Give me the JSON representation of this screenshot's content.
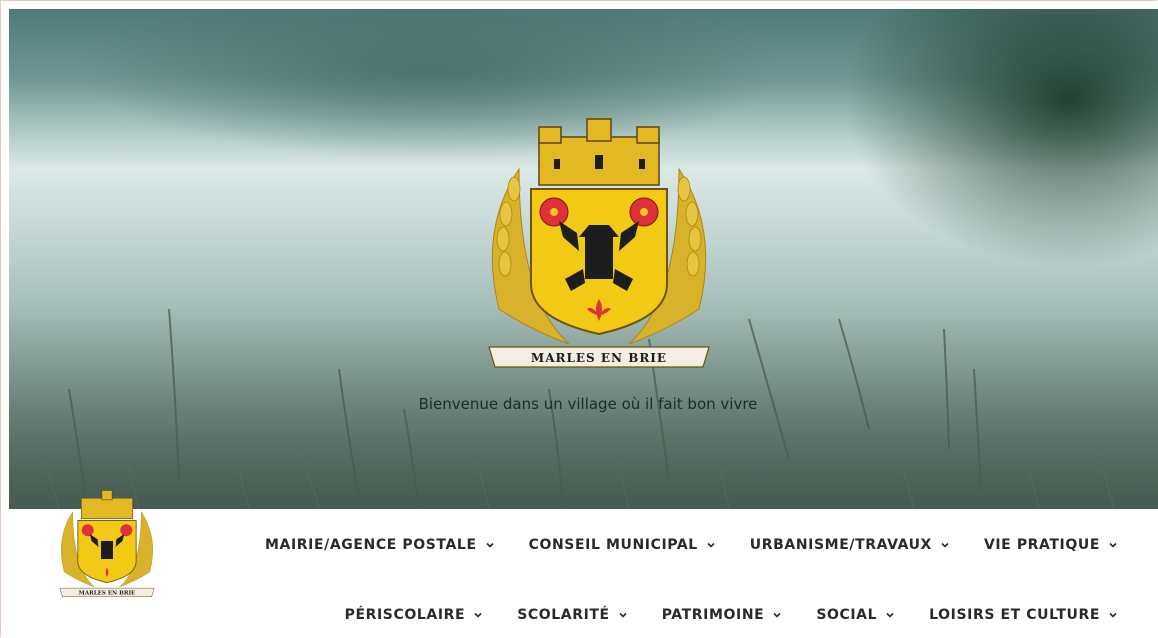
{
  "hero": {
    "tagline": "Bienvenue dans un village où il fait bon vivre",
    "crest_banner": "MARLES EN BRIE"
  },
  "nav": {
    "logo_banner": "MARLES EN BRIE",
    "row1": [
      {
        "label": "MAIRIE/AGENCE POSTALE"
      },
      {
        "label": "CONSEIL MUNICIPAL"
      },
      {
        "label": "URBANISME/TRAVAUX"
      },
      {
        "label": "VIE PRATIQUE"
      }
    ],
    "row2": [
      {
        "label": "PÉRISCOLAIRE"
      },
      {
        "label": "SCOLARITÉ"
      },
      {
        "label": "PATRIMOINE"
      },
      {
        "label": "SOCIAL"
      },
      {
        "label": "LOISIRS ET CULTURE"
      }
    ]
  },
  "colors": {
    "shield_gold": "#f2c914",
    "rose_red": "#e0313a",
    "mill_black": "#1d1d1d",
    "wheat": "#d9b22c"
  },
  "icons": [
    "chevron-down-icon",
    "coat-of-arms-logo"
  ]
}
